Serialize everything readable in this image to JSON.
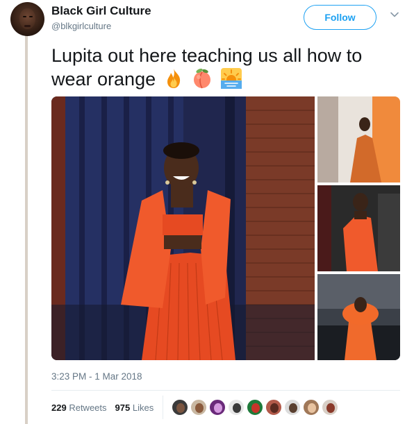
{
  "author": {
    "display_name": "Black Girl Culture",
    "handle": "@blkgirlculture"
  },
  "follow_label": "Follow",
  "tweet": {
    "text": "Lupita out here teaching us all how to wear orange",
    "emojis": [
      "fire-emoji",
      "peach-emoji",
      "sunrise-emoji"
    ]
  },
  "timestamp": "3:23 PM - 1 Mar 2018",
  "stats": {
    "retweets_count": "229",
    "retweets_label": "Retweets",
    "likes_count": "975",
    "likes_label": "Likes"
  },
  "likers": [
    {
      "bg": "#3b3b3b",
      "face": "#7a5540"
    },
    {
      "bg": "#c9b8a2",
      "face": "#8a5a3c"
    },
    {
      "bg": "#6a2a7a",
      "face": "#d59ae0"
    },
    {
      "bg": "#e7e7e7",
      "face": "#3a3a3a"
    },
    {
      "bg": "#1f7a3a",
      "face": "#c8342a"
    },
    {
      "bg": "#b25a4a",
      "face": "#5a2a20"
    },
    {
      "bg": "#dcdcdc",
      "face": "#5a4030"
    },
    {
      "bg": "#a07858",
      "face": "#e8c3a0"
    },
    {
      "bg": "#d8cfc6",
      "face": "#8a3a2a"
    }
  ],
  "colors": {
    "accent": "#1da1f2",
    "outfit_orange": "#f0542a",
    "thread_line": "#d8d0c6"
  }
}
